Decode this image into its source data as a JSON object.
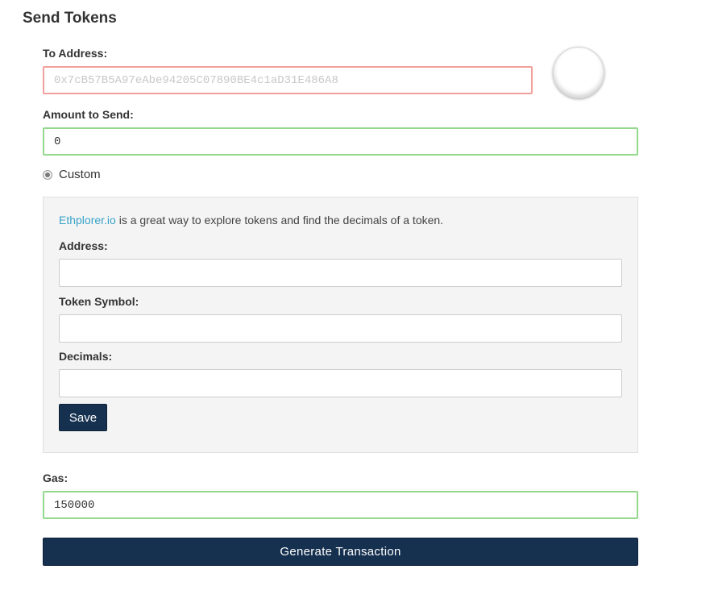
{
  "page": {
    "title": "Send Tokens"
  },
  "to_address": {
    "label": "To Address:",
    "placeholder": "0x7cB57B5A97eAbe94205C07890BE4c1aD31E486A8",
    "value": ""
  },
  "amount": {
    "label": "Amount to Send:",
    "value": "0"
  },
  "token_option": {
    "label": "Custom",
    "selected": true
  },
  "custom_token": {
    "hint_link": "Ethplorer.io",
    "hint_text": " is a great way to explore tokens and find the decimals of a token.",
    "address_label": "Address:",
    "address_value": "",
    "symbol_label": "Token Symbol:",
    "symbol_value": "",
    "decimals_label": "Decimals:",
    "decimals_value": "",
    "save_label": "Save"
  },
  "gas": {
    "label": "Gas:",
    "value": "150000"
  },
  "actions": {
    "generate_label": "Generate Transaction"
  },
  "colors": {
    "primary_button": "#163150",
    "invalid_border": "#f2a09b",
    "valid_border": "#94d88e",
    "link": "#3aa3c9"
  }
}
